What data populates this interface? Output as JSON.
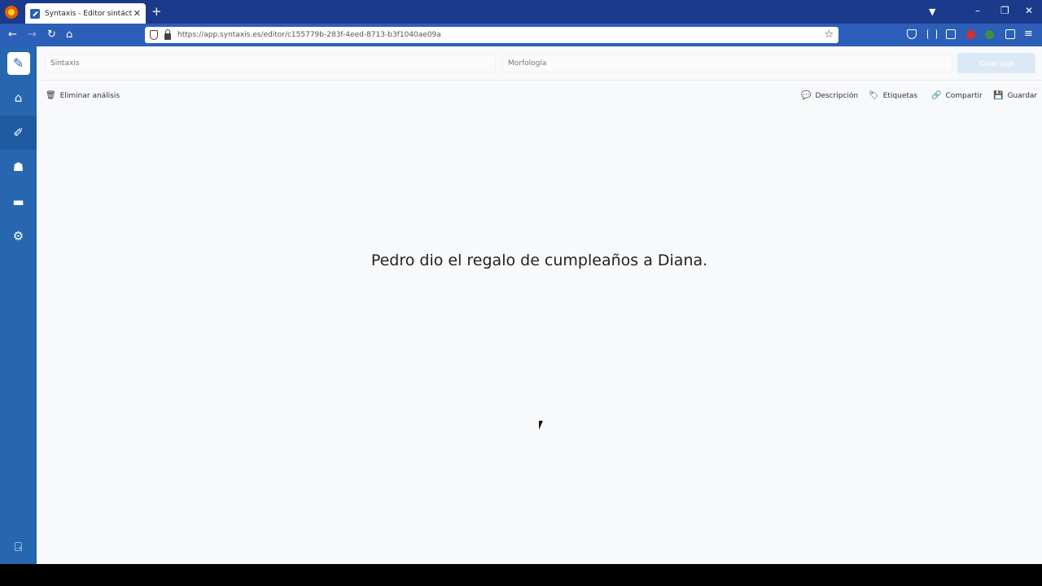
{
  "browser": {
    "tab_title": "Syntaxis - Editor sintáctico para",
    "url": "https://app.syntaxis.es/editor/c155779b-283f-4eed-8713-b3f1040ae09a"
  },
  "toolbar_icons": [
    "pocket-icon",
    "library-icon",
    "sidebar-icon",
    "extension-red-icon",
    "extension-green-icon",
    "extensions-icon",
    "hamburger-menu-icon"
  ],
  "sidebar": {
    "items": [
      "pencil-icon",
      "home-icon",
      "edit-icon",
      "users-icon",
      "archive-icon",
      "gear-icon",
      "logout-icon"
    ]
  },
  "editor": {
    "syntax_placeholder": "Sintaxis",
    "morphology_placeholder": "Morfología",
    "create_button": "Crear caja",
    "delete_label": "Eliminar análisis",
    "description_label": "Descripción",
    "tags_label": "Etiquetas",
    "share_label": "Compartir",
    "save_label": "Guardar",
    "sentence": "Pedro dio el regalo de cumpleaños a Diana."
  },
  "colors": {
    "sidebar": "#2667b0",
    "tabbar": "#1b3a8c",
    "navbar": "#2b5fb8",
    "create_button": "#dbe9f7"
  }
}
